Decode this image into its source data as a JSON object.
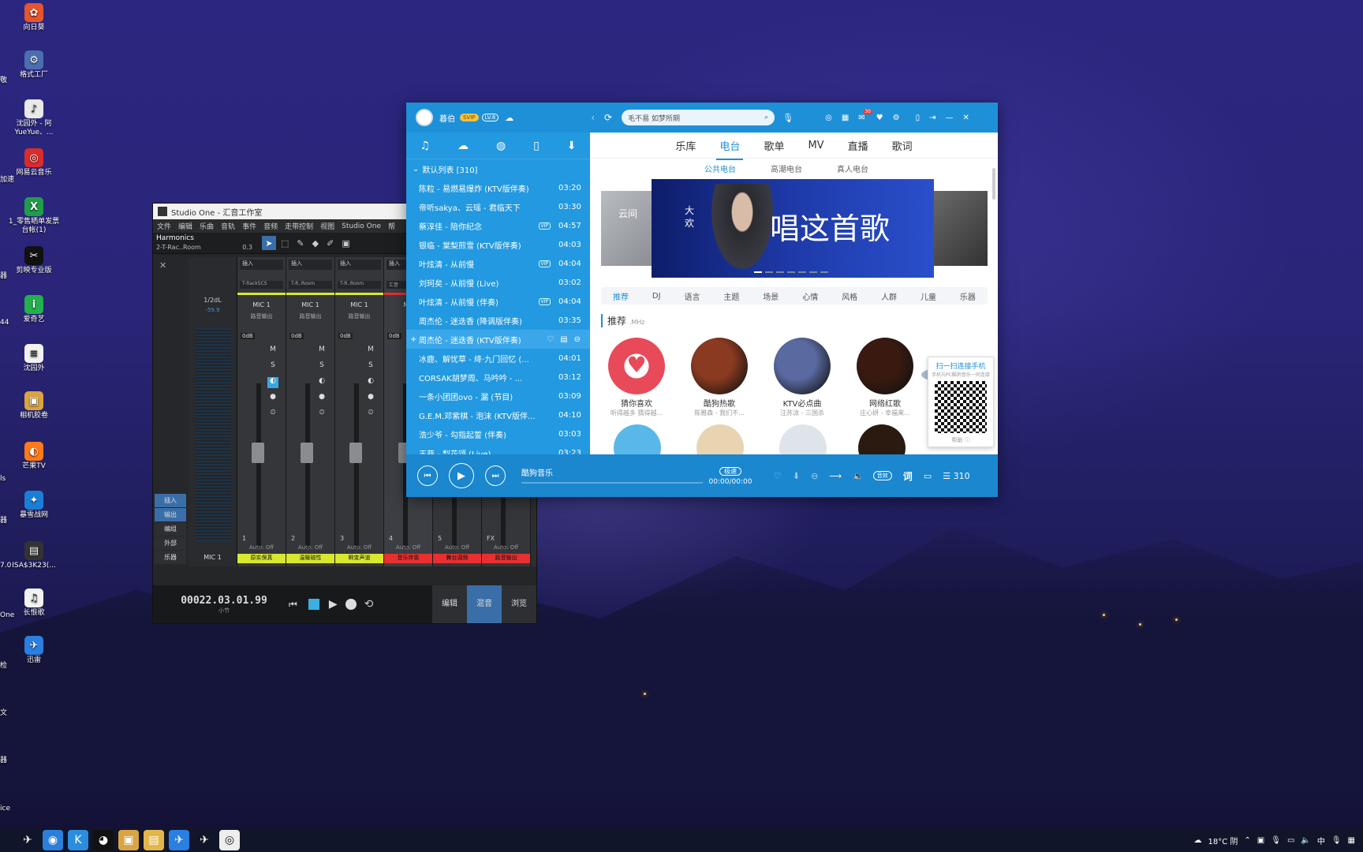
{
  "desktop": {
    "icons": [
      {
        "label": "向日葵",
        "color": "#e8542b",
        "glyph": "✿"
      },
      {
        "label": "格式工厂",
        "color": "#4a6fb0",
        "glyph": "⚙"
      },
      {
        "label": "沈园外 - 阿YueYue、...",
        "color": "#e9e9e9",
        "glyph": "♪"
      },
      {
        "label": "网易云音乐",
        "color": "#d92c2c",
        "glyph": "◎"
      },
      {
        "label": "1_零售晒单发票台帐(1)",
        "color": "#1f9d4a",
        "glyph": "X"
      },
      {
        "label": "剪映专业版",
        "color": "#111111",
        "glyph": "✂"
      },
      {
        "label": "爱奇艺",
        "color": "#22b14c",
        "glyph": "i"
      },
      {
        "label": "沈园外",
        "color": "#f2f2f2",
        "glyph": "≡"
      },
      {
        "label": "相机胶卷",
        "color": "#d9a441",
        "glyph": "▣"
      },
      {
        "label": "芒果TV",
        "color": "#ff7a1a",
        "glyph": "◐"
      },
      {
        "label": "暴雪战网",
        "color": "#1b7ed6",
        "glyph": "✦"
      },
      {
        "label": "ISA$3K23(...",
        "color": "#333333",
        "glyph": "▤"
      },
      {
        "label": "长恨歌",
        "color": "#f2f2f2",
        "glyph": "♫"
      },
      {
        "label": "迅雷",
        "color": "#2a7fe0",
        "glyph": "✈"
      }
    ],
    "left_fragments": [
      "敬",
      "加速",
      "器",
      "44",
      "ls",
      "器",
      "7.0",
      "One",
      "检",
      "文",
      "器",
      "ice"
    ]
  },
  "taskbar": {
    "apps": [
      {
        "name": "feishu-icon",
        "glyph": "✈",
        "color": "#11152a"
      },
      {
        "name": "browser-icon",
        "glyph": "◉",
        "color": "#2b7fd8"
      },
      {
        "name": "kugou-icon",
        "glyph": "K",
        "color": "#2a8de0"
      },
      {
        "name": "qq-icon",
        "glyph": "◕",
        "color": "#111"
      },
      {
        "name": "files-icon",
        "glyph": "▣",
        "color": "#d9a441"
      },
      {
        "name": "folder-icon",
        "glyph": "▤",
        "color": "#e3b64a"
      },
      {
        "name": "xunlei-icon",
        "glyph": "✈",
        "color": "#2a7fe0"
      },
      {
        "name": "feishu2-icon",
        "glyph": "✈",
        "color": "#11152a"
      },
      {
        "name": "studio-icon",
        "glyph": "◎",
        "color": "#eee"
      }
    ],
    "weather": "18°C 阴",
    "ime": "中"
  },
  "studio_one": {
    "title": "Studio One - 汇音工作室",
    "menu": [
      "文件",
      "编辑",
      "乐曲",
      "音轨",
      "事件",
      "音频",
      "走带控制",
      "视图",
      "Studio One",
      "帮"
    ],
    "track_name": "Harmonics",
    "preset": "2-T-Rac..Room",
    "value": "0.3",
    "master_label": "1/2dL",
    "master_db": "-59.9",
    "master_name": "MIC 1",
    "side_buttons": [
      "插入",
      "输出",
      "编组",
      "外部",
      "乐器"
    ],
    "strips": [
      {
        "insert": "插入",
        "fx": "T-RackSCS",
        "ch": "MIC 1",
        "out": "路音输出",
        "db": "0dB",
        "num": "1",
        "auto": "Auto: Off",
        "name": "原实保真",
        "color": "#d8e830"
      },
      {
        "insert": "插入",
        "fx": "T-R..Room",
        "ch": "MIC 1",
        "out": "路音输出",
        "db": "0dB",
        "num": "2",
        "auto": "Auto: Off",
        "name": "温暖磁性",
        "color": "#d8e830"
      },
      {
        "insert": "插入",
        "fx": "T-R..Room",
        "ch": "MIC 1",
        "out": "路音输出",
        "db": "0dB",
        "num": "3",
        "auto": "Auto: Off",
        "name": "瞬变声道",
        "color": "#d8e830"
      },
      {
        "insert": "插入",
        "fx": "汇音",
        "ch": "Mu",
        "out": "",
        "db": "0dB",
        "num": "4",
        "auto": "Auto: Off",
        "name": "音乐伴奏",
        "color": "#e83030"
      },
      {
        "insert": "",
        "fx": "",
        "ch": "",
        "out": "",
        "db": "",
        "num": "5",
        "auto": "Auto: Off",
        "name": "舞台调频",
        "color": "#e83030"
      },
      {
        "insert": "",
        "fx": "",
        "ch": "",
        "out": "",
        "db": "",
        "num": "FX",
        "auto": "Auto: Off",
        "name": "路音输出",
        "color": "#e83030"
      }
    ],
    "time": "00022.03.01.99",
    "time_unit": "小节",
    "tabs": [
      "编辑",
      "混音",
      "浏览"
    ],
    "active_tab": "混音"
  },
  "kugou": {
    "user": "暮伯",
    "vip_badge": "SVIP",
    "level": "LV.8",
    "search_placeholder": "毛不易 如梦所期",
    "mail_count": "30",
    "side_tabs": [
      "♫",
      "☁",
      "◍",
      "▯",
      "⬇"
    ],
    "list_head": "默认列表 [310]",
    "songs": [
      {
        "t": "陈粒 - 易燃易爆炸 (KTV版伴奏)",
        "d": "03:20",
        "tag": ""
      },
      {
        "t": "帝听sakya、云瑶 - 君临天下",
        "d": "03:30",
        "tag": ""
      },
      {
        "t": "蔡淳佳 - 陪你纪念",
        "d": "04:57",
        "tag": "VIP"
      },
      {
        "t": "银临 - 棠梨煎雪 (KTV版伴奏)",
        "d": "04:03",
        "tag": ""
      },
      {
        "t": "叶炫清 - 从前慢",
        "d": "04:04",
        "tag": "VIP"
      },
      {
        "t": "刘珂矣 - 从前慢 (Live)",
        "d": "03:02",
        "tag": ""
      },
      {
        "t": "叶炫清 - 从前慢 (伴奏)",
        "d": "04:04",
        "tag": "VIP"
      },
      {
        "t": "周杰伦 - 迷迭香 (降调版伴奏)",
        "d": "03:35",
        "tag": ""
      },
      {
        "t": "周杰伦 - 迷迭香 (KTV版伴奏)",
        "d": "",
        "tag": "",
        "active": true
      },
      {
        "t": "冰鹿、解忧草 - 绛·九门回忆 (...",
        "d": "04:01",
        "tag": ""
      },
      {
        "t": "CORSAK胡梦周、马吟吟 - ...",
        "d": "03:12",
        "tag": ""
      },
      {
        "t": "一条小团团ovo - 漏 (节目)",
        "d": "03:09",
        "tag": ""
      },
      {
        "t": "G.E.M.邓紫棋 - 泡沫 (KTV版伴...",
        "d": "04:10",
        "tag": ""
      },
      {
        "t": "浩少爷 - 勾指起誓 (伴奏)",
        "d": "03:03",
        "tag": ""
      },
      {
        "t": "王菲 - 梨花颂 (Live)",
        "d": "03:23",
        "tag": ""
      }
    ],
    "nav": [
      "乐库",
      "电台",
      "歌单",
      "MV",
      "直播",
      "歌词"
    ],
    "nav_active": "电台",
    "subnav": [
      "公共电台",
      "高潮电台",
      "真人电台"
    ],
    "banner": {
      "small": "大欢",
      "big": "唱这首歌",
      "side": "云间"
    },
    "cats": [
      "推荐",
      "DJ",
      "语言",
      "主题",
      "场景",
      "心情",
      "风格",
      "人群",
      "儿童",
      "乐器"
    ],
    "rec_title": "推荐",
    "rec_unit": ".MHz",
    "cards": [
      {
        "n": "猜你喜欢",
        "s": "听得越多 猜得越...",
        "color": "#e84a5a"
      },
      {
        "n": "酷狗热歌",
        "s": "陈雅森 - 我们不...",
        "color": "#8a3a20"
      },
      {
        "n": "KTV必点曲",
        "s": "汪苏泷 - 三国杀",
        "color": "#5a6aa0"
      },
      {
        "n": "网络红歌",
        "s": "庄心妍 - 幸福来...",
        "color": "#3a1a10"
      }
    ],
    "qr_title": "扫一扫连接手机",
    "qr_sub": "手机与PC酷狗音乐一同连接",
    "qr_help": "帮助 ⓘ",
    "player": {
      "title": "酷狗音乐",
      "quality": "极速",
      "time": "00:00/00:00",
      "count": "310",
      "lyric": "词",
      "sound": "音效"
    }
  }
}
